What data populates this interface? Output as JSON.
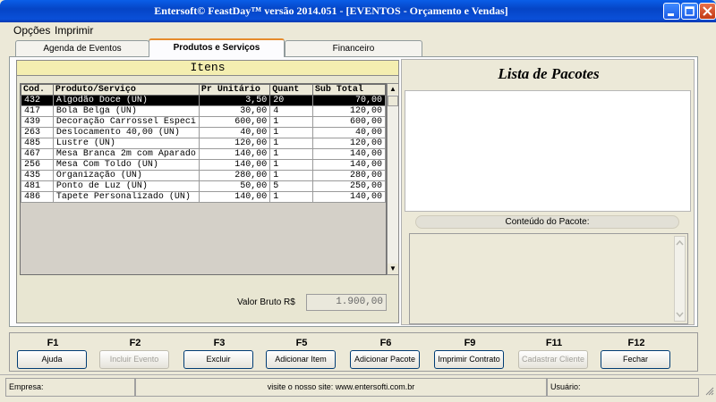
{
  "window": {
    "title": "Entersoft© FeastDay™ versão 2014.051 - [EVENTOS - Orçamento e Vendas]",
    "colors": {
      "titlebar": "#0a4fd8",
      "close": "#c23b14",
      "accent_tab": "#e68b2c",
      "items_header": "#f4eeb0"
    }
  },
  "menu": {
    "items": [
      "Opções",
      "Imprimir"
    ]
  },
  "tabs": [
    {
      "label": "Agenda de Eventos",
      "active": false
    },
    {
      "label": "Produtos e Serviços",
      "active": true
    },
    {
      "label": "Financeiro",
      "active": false
    }
  ],
  "items": {
    "header": "Itens",
    "columns": [
      "Cod.",
      "Produto/Serviço",
      "Pr Unitário",
      "Quant",
      "Sub Total"
    ],
    "rows": [
      [
        "432",
        "Algodão Doce (UN)",
        "3,50",
        "20",
        "70,00"
      ],
      [
        "417",
        "Bola Belga (UN)",
        "30,00",
        "4",
        "120,00"
      ],
      [
        "439",
        "Decoração Carrossel Especi",
        "600,00",
        "1",
        "600,00"
      ],
      [
        "263",
        "Deslocamento 40,00 (UN)",
        "40,00",
        "1",
        "40,00"
      ],
      [
        "485",
        "Lustre (UN)",
        "120,00",
        "1",
        "120,00"
      ],
      [
        "467",
        "Mesa Branca 2m com Aparado",
        "140,00",
        "1",
        "140,00"
      ],
      [
        "256",
        "Mesa Com Toldo (UN)",
        "140,00",
        "1",
        "140,00"
      ],
      [
        "435",
        "Organização (UN)",
        "280,00",
        "1",
        "280,00"
      ],
      [
        "481",
        "Ponto de Luz (UN)",
        "50,00",
        "5",
        "250,00"
      ],
      [
        "486",
        "Tapete Personalizado (UN)",
        "140,00",
        "1",
        "140,00"
      ]
    ],
    "selected_row": 0,
    "valor_bruto_label": "Valor Bruto R$",
    "valor_bruto_value": "1.900,00"
  },
  "pacotes": {
    "title": "Lista de Pacotes",
    "conteudo_label": "Conteúdo do Pacote:"
  },
  "fkeys": [
    {
      "key": "F1",
      "label": "Ajuda",
      "enabled": true
    },
    {
      "key": "F2",
      "label": "Incluir Evento",
      "enabled": false
    },
    {
      "key": "F3",
      "label": "Excluir",
      "enabled": true
    },
    {
      "key": "F5",
      "label": "Adicionar Item",
      "enabled": true
    },
    {
      "key": "F6",
      "label": "Adicionar Pacote",
      "enabled": true
    },
    {
      "key": "F9",
      "label": "Imprimir Contrato",
      "enabled": true
    },
    {
      "key": "F11",
      "label": "Cadastrar Cliente",
      "enabled": false
    },
    {
      "key": "F12",
      "label": "Fechar",
      "enabled": true
    }
  ],
  "status": {
    "empresa": "Empresa:",
    "site": "visite o nosso site: www.entersofti.com.br",
    "usuario": "Usuário:"
  },
  "icons": [
    "minimize-icon",
    "maximize-icon",
    "close-icon",
    "scroll-up-icon",
    "scroll-down-icon",
    "resize-grip-icon"
  ]
}
